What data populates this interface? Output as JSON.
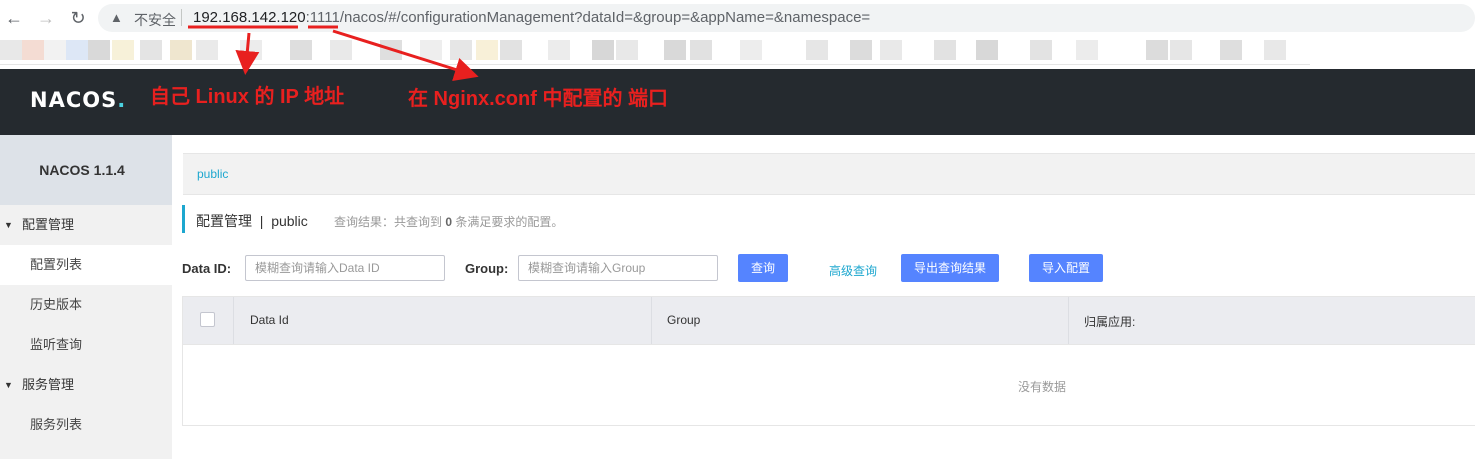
{
  "browser": {
    "back_icon": "back-arrow-icon",
    "forward_icon": "forward-arrow-icon",
    "reload_icon": "reload-icon",
    "security_label": "不安全",
    "url_host": "192.168.142.120",
    "url_colon": ":",
    "url_port": "1111",
    "url_path": "/nacos/#/configurationManagement?dataId=&group=&appName=&namespace="
  },
  "header": {
    "logo_main": "NACOS",
    "logo_dot": "."
  },
  "annotations": {
    "ip_note": "自己 Linux 的 IP 地址",
    "port_note": "在 Nginx.conf 中配置的 端口",
    "arrow_color": "#e8201f"
  },
  "sidebar": {
    "version": "NACOS 1.1.4",
    "groups": [
      {
        "label": "配置管理",
        "items": [
          "配置列表",
          "历史版本",
          "监听查询"
        ]
      },
      {
        "label": "服务管理",
        "items": [
          "服务列表"
        ]
      }
    ]
  },
  "main": {
    "namespace_tab": "public",
    "title": "配置管理",
    "title_sep": "|",
    "title_ns": "public",
    "result_prefix": "查询结果：共查询到",
    "result_count": "0",
    "result_suffix": "条满足要求的配置。",
    "dataid_label": "Data ID:",
    "dataid_placeholder": "模糊查询请输入Data ID",
    "group_label": "Group:",
    "group_placeholder": "模糊查询请输入Group",
    "query_button": "查询",
    "advanced_link": "高级查询",
    "export_button": "导出查询结果",
    "import_button": "导入配置",
    "columns": [
      "Data Id",
      "Group",
      "归属应用:"
    ],
    "empty_text": "没有数据"
  },
  "colors": {
    "header_bg": "#252a2f",
    "accent": "#1da7cf",
    "button": "#5584ff"
  }
}
